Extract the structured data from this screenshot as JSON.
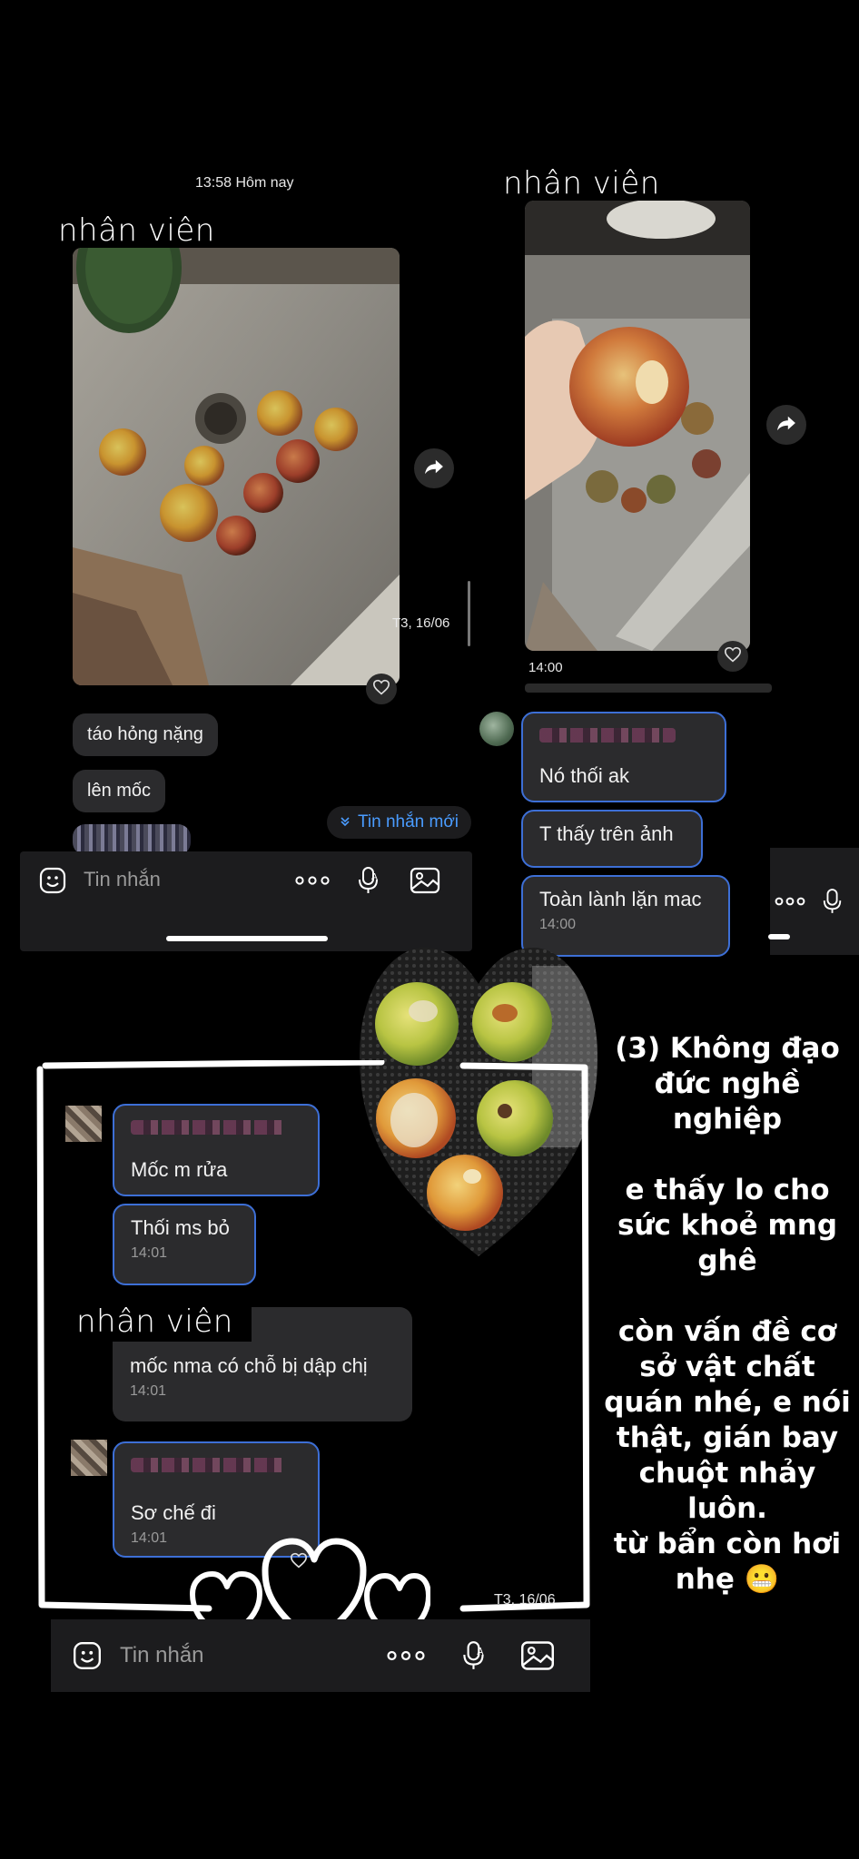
{
  "panel1": {
    "timestamp": "13:58 Hôm nay",
    "name_tag": "nhân viên",
    "photo_time": "T3, 16/06",
    "messages": [
      "táo hỏng nặng",
      "lên mốc"
    ],
    "new_messages_label": "Tin nhắn mới",
    "composer_placeholder": "Tin nhắn"
  },
  "panel2": {
    "name_tag": "nhân viên",
    "photo_time": "14:00",
    "messages": [
      {
        "text": "Nó thối ak",
        "time": ""
      },
      {
        "text": "T thấy trên ảnh",
        "time": ""
      },
      {
        "text": "Toàn lành lặn mac",
        "time": "14:00"
      }
    ]
  },
  "panel3": {
    "name_tag": "nhân viên",
    "messages_a": [
      {
        "text": "Mốc m rửa",
        "time": ""
      },
      {
        "text": "Thối ms bỏ",
        "time": "14:01"
      }
    ],
    "staff_reply": {
      "text": "mốc nma có chỗ bị dập chị",
      "time": "14:01"
    },
    "messages_b": [
      {
        "text": "Sơ chế đi",
        "time": "14:01"
      }
    ],
    "footer_time": "T3, 16/06",
    "composer_placeholder": "Tin nhắn"
  },
  "caption": {
    "line1": "(3) Không đạo",
    "line2": "đức nghề",
    "line3": "nghiệp",
    "line4": "e thấy lo cho",
    "line5": "sức khoẻ mng",
    "line6": "ghê",
    "line7": "còn vấn đề cơ",
    "line8": "sở vật chất",
    "line9": "quán nhé, e nói",
    "line10": "thật, gián bay",
    "line11": "chuột nhảy",
    "line12": "luôn.",
    "line13": "từ bẩn còn hơi",
    "line14": "nhẹ 😬"
  },
  "colors": {
    "background": "#000000",
    "bubble": "#2b2b2d",
    "highlight_border": "#3d6fd6",
    "link": "#4a9cff"
  }
}
